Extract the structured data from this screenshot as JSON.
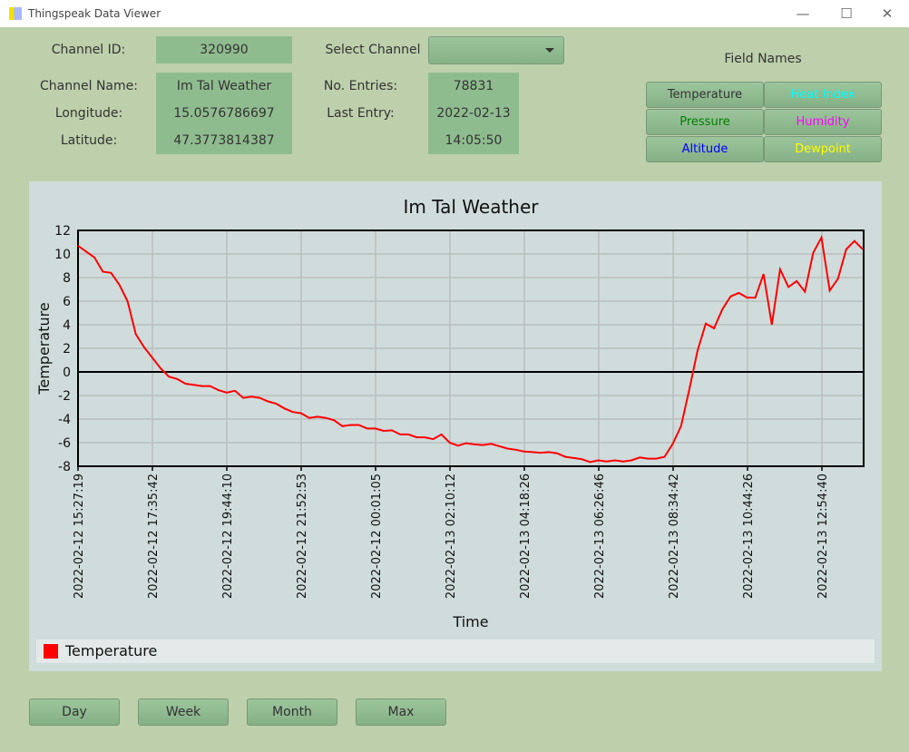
{
  "window": {
    "title": "Thingspeak Data Viewer",
    "minimize": "—",
    "maximize": "☐",
    "close": "✕"
  },
  "info": {
    "channel_id_label": "Channel ID:",
    "channel_id": "320990",
    "select_channel_label": "Select Channel",
    "select_channel_value": "",
    "channel_name_label": "Channel Name:",
    "channel_name": "Im Tal Weather",
    "longitude_label": "Longitude:",
    "longitude": "15.0576786697",
    "latitude_label": "Latitude:",
    "latitude": "47.3773814387",
    "entries_label": "No. Entries:",
    "entries": "78831",
    "last_entry_label": "Last Entry:",
    "last_entry_date": "2022-02-13",
    "last_entry_time": "14:05:50"
  },
  "fields": {
    "title": "Field Names",
    "buttons": [
      {
        "label": "Temperature",
        "color": "#333333"
      },
      {
        "label": "Heat Index",
        "color": "#00ffff"
      },
      {
        "label": "Pressure",
        "color": "#008000"
      },
      {
        "label": "Humidity",
        "color": "#ff00ff"
      },
      {
        "label": "Altitude",
        "color": "#0000ff"
      },
      {
        "label": "Dewpoint",
        "color": "#ffff00"
      }
    ]
  },
  "range_buttons": [
    "Day",
    "Week",
    "Month",
    "Max"
  ],
  "chart_data": {
    "type": "line",
    "title": "Im Tal Weather",
    "xlabel": "Time",
    "ylabel": "Temperature",
    "ylim": [
      -8,
      12
    ],
    "yticks": [
      -8,
      -6,
      -4,
      -2,
      0,
      2,
      4,
      6,
      8,
      10,
      12
    ],
    "grid": true,
    "legend_position": "bottom",
    "xticks": [
      "2022-02-12 15:27:19",
      "2022-02-12 17:35:42",
      "2022-02-12 19:44:10",
      "2022-02-12 21:52:53",
      "2022-02-12 00:01:05",
      "2022-02-13 02:10:12",
      "2022-02-13 04:18:26",
      "2022-02-13 06:26:46",
      "2022-02-13 08:34:42",
      "2022-02-13 10:44:26",
      "2022-02-13 12:54:40"
    ],
    "series": [
      {
        "name": "Temperature",
        "color": "#ff0000",
        "values": [
          10.7,
          10.2,
          9.7,
          8.5,
          8.4,
          7.4,
          6.0,
          3.2,
          2.1,
          1.2,
          0.3,
          -0.4,
          -0.6,
          -1.0,
          -1.1,
          -1.2,
          -1.2,
          -1.55,
          -1.75,
          -1.6,
          -2.2,
          -2.1,
          -2.2,
          -2.5,
          -2.7,
          -3.1,
          -3.4,
          -3.5,
          -3.9,
          -3.8,
          -3.9,
          -4.1,
          -4.6,
          -4.5,
          -4.5,
          -4.8,
          -4.8,
          -5.0,
          -4.95,
          -5.3,
          -5.3,
          -5.55,
          -5.55,
          -5.7,
          -5.3,
          -6.0,
          -6.25,
          -6.05,
          -6.15,
          -6.2,
          -6.1,
          -6.3,
          -6.5,
          -6.6,
          -6.75,
          -6.8,
          -6.85,
          -6.8,
          -6.9,
          -7.2,
          -7.3,
          -7.4,
          -7.65,
          -7.5,
          -7.6,
          -7.5,
          -7.6,
          -7.5,
          -7.25,
          -7.35,
          -7.35,
          -7.2,
          -6.1,
          -4.6,
          -1.5,
          1.8,
          4.1,
          3.7,
          5.3,
          6.4,
          6.7,
          6.3,
          6.3,
          8.3,
          4.0,
          8.7,
          7.2,
          7.7,
          6.8,
          10.1,
          11.4,
          6.9,
          7.9,
          10.4,
          11.1,
          10.4
        ]
      }
    ]
  }
}
